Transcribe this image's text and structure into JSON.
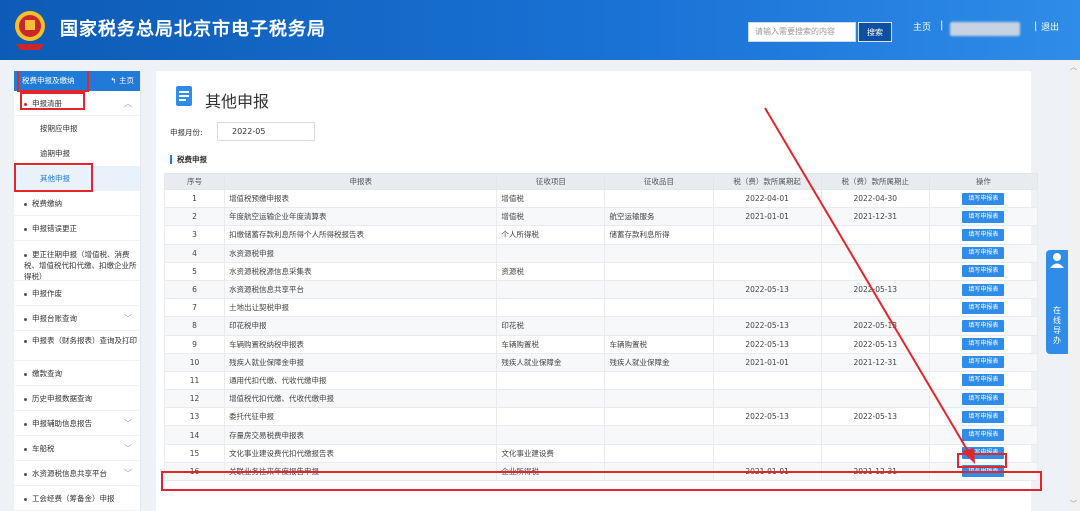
{
  "header": {
    "site_title": "国家税务总局北京市电子税务局",
    "search_placeholder": "请输入需要搜索的内容",
    "search_button": "搜索",
    "home_link": "主页",
    "separator": "|",
    "logout_link": "退出",
    "brand_color": "#1565c0"
  },
  "sidebar": {
    "head_label": "税费申报及缴纳",
    "head_home": "主页",
    "items": [
      {
        "label": "申报清册"
      },
      {
        "label": "按期应申报"
      },
      {
        "label": "逾期申报"
      },
      {
        "label": "其他申报"
      },
      {
        "label": "税费缴纳"
      },
      {
        "label": "申报错误更正"
      },
      {
        "label": "更正往期申报（增值税、消费税、增值税代扣代缴、扣缴企业所得税）"
      },
      {
        "label": "申报作废"
      },
      {
        "label": "申报台账查询"
      },
      {
        "label": "申报表（财务报表）查询及打印"
      },
      {
        "label": "缴款查询"
      },
      {
        "label": "历史申报数据查询"
      },
      {
        "label": "申报辅助信息报告"
      },
      {
        "label": "车船税"
      },
      {
        "label": "水资源税信息共享平台"
      },
      {
        "label": "工会经费（筹备金）申报"
      }
    ]
  },
  "main": {
    "page_title": "其他申报",
    "month_label": "申报月份:",
    "month_value": "2022-05",
    "section_title": "税费申报",
    "columns": [
      "序号",
      "申报表",
      "征收项目",
      "征收品目",
      "税（费）款所属期起",
      "税（费）款所属期止",
      "操作"
    ],
    "action_label": "填写申报表",
    "rows": [
      {
        "no": "1",
        "form": "增值税预缴申报表",
        "item": "增值税",
        "sub": "",
        "start": "2022-04-01",
        "end": "2022-04-30"
      },
      {
        "no": "2",
        "form": "年度航空运输企业年度清算表",
        "item": "增值税",
        "sub": "航空运输服务",
        "start": "2021-01-01",
        "end": "2021-12-31"
      },
      {
        "no": "3",
        "form": "扣缴储蓄存款利息所得个人所得税报告表",
        "item": "个人所得税",
        "sub": "储蓄存款利息所得",
        "start": "",
        "end": ""
      },
      {
        "no": "4",
        "form": "水资源税申报",
        "item": "",
        "sub": "",
        "start": "",
        "end": ""
      },
      {
        "no": "5",
        "form": "水资源税税源信息采集表",
        "item": "资源税",
        "sub": "",
        "start": "",
        "end": ""
      },
      {
        "no": "6",
        "form": "水资源税信息共享平台",
        "item": "",
        "sub": "",
        "start": "2022-05-13",
        "end": "2022-05-13"
      },
      {
        "no": "7",
        "form": "土地出让契税申报",
        "item": "",
        "sub": "",
        "start": "",
        "end": ""
      },
      {
        "no": "8",
        "form": "印花税申报",
        "item": "印花税",
        "sub": "",
        "start": "2022-05-13",
        "end": "2022-05-13"
      },
      {
        "no": "9",
        "form": "车辆购置税纳税申报表",
        "item": "车辆购置税",
        "sub": "车辆购置税",
        "start": "2022-05-13",
        "end": "2022-05-13"
      },
      {
        "no": "10",
        "form": "残疾人就业保障金申报",
        "item": "残疾人就业保障金",
        "sub": "残疾人就业保障金",
        "start": "2021-01-01",
        "end": "2021-12-31"
      },
      {
        "no": "11",
        "form": "通用代扣代缴、代收代缴申报",
        "item": "",
        "sub": "",
        "start": "",
        "end": ""
      },
      {
        "no": "12",
        "form": "增值税代扣代缴、代收代缴申报",
        "item": "",
        "sub": "",
        "start": "",
        "end": ""
      },
      {
        "no": "13",
        "form": "委托代征申报",
        "item": "",
        "sub": "",
        "start": "2022-05-13",
        "end": "2022-05-13"
      },
      {
        "no": "14",
        "form": "存量房交易税费申报表",
        "item": "",
        "sub": "",
        "start": "",
        "end": ""
      },
      {
        "no": "15",
        "form": "文化事业建设费代扣代缴报告表",
        "item": "文化事业建设费",
        "sub": "",
        "start": "",
        "end": ""
      },
      {
        "no": "16",
        "form": "关联业务往来年度报告申报",
        "item": "企业所得税",
        "sub": "",
        "start": "2021-01-01",
        "end": "2021-12-31"
      }
    ]
  },
  "online_guide": {
    "label": "在线导办"
  }
}
